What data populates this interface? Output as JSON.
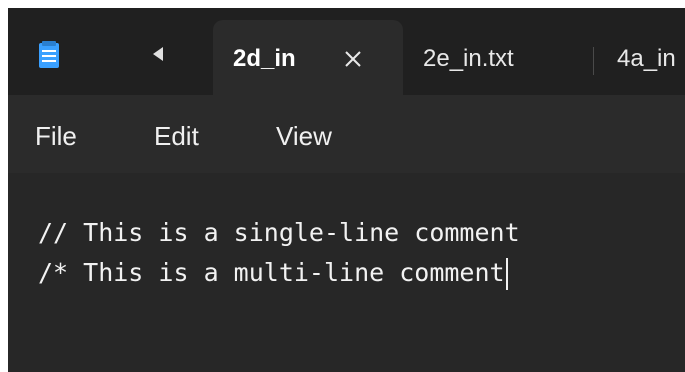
{
  "tabs": [
    {
      "label": "2d_in",
      "active": true
    },
    {
      "label": "2e_in.txt",
      "active": false
    },
    {
      "label": "4a_in",
      "active": false
    }
  ],
  "icons": {
    "app": "notepad-icon",
    "scroll": "scroll-left-icon",
    "close": "close-icon"
  },
  "menu": {
    "file": "File",
    "edit": "Edit",
    "view": "View"
  },
  "editor": {
    "lines": [
      "// This is a single-line comment",
      "/* This is a multi-line comment"
    ]
  },
  "colors": {
    "background": "#202020",
    "active_tab": "#2b2b2b",
    "editor": "#272727",
    "text": "#f2f2f2",
    "icon_accent": "#3aa0ff"
  }
}
